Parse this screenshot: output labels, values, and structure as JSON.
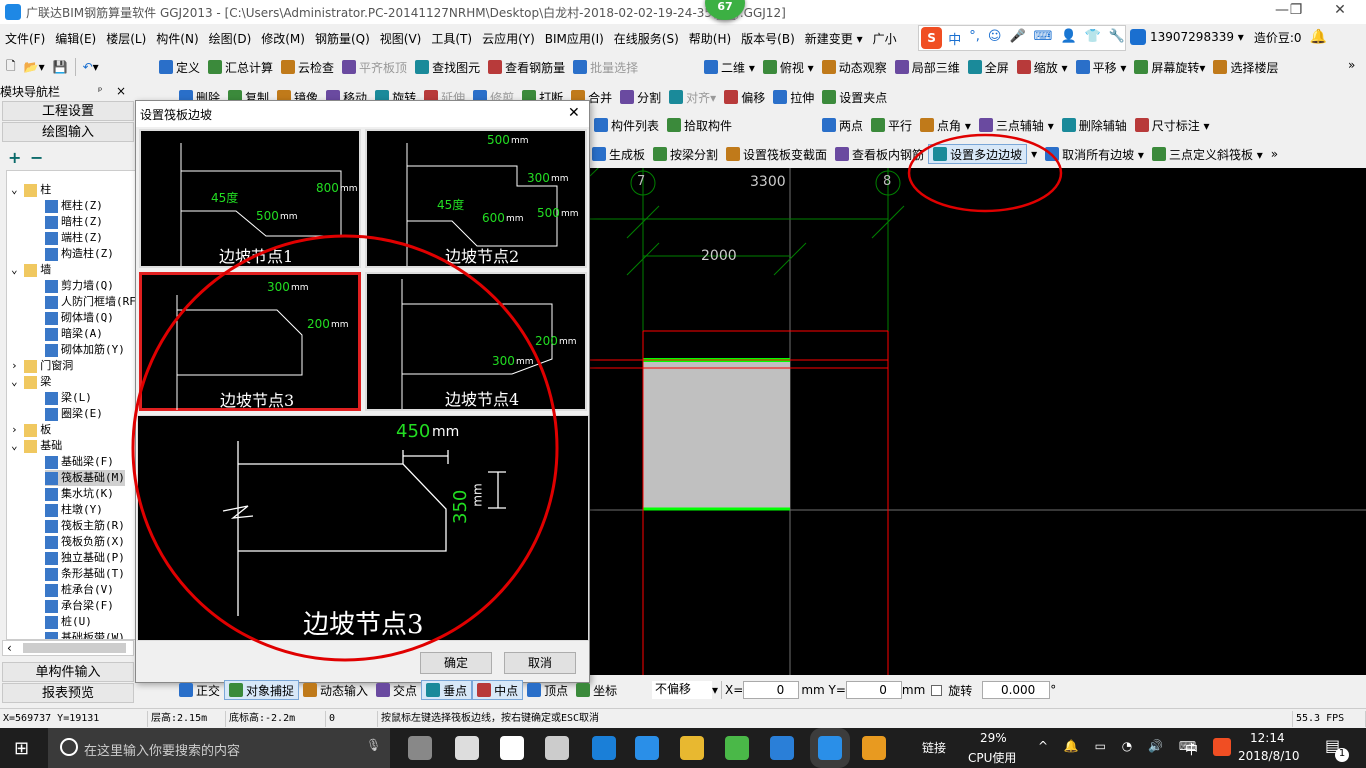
{
  "title": "广联达BIM钢筋算量软件 GGJ2013 - [C:\\Users\\Administrator.PC-20141127NRHM\\Desktop\\白龙村-2018-02-02-19-24-35(██).GGJ12]",
  "badge": "67",
  "window_controls": {
    "min": "—",
    "max": "❐",
    "close": "✕"
  },
  "menu": [
    "文件(F)",
    "编辑(E)",
    "楼层(L)",
    "构件(N)",
    "绘图(D)",
    "修改(M)",
    "钢筋量(Q)",
    "视图(V)",
    "工具(T)",
    "云应用(Y)",
    "BIM应用(I)",
    "在线服务(S)",
    "帮助(H)",
    "版本号(B)",
    "新建变更 ▾",
    "广小"
  ],
  "ime": {
    "logo": "S",
    "items": [
      "中",
      "°,",
      "☺",
      "🎤",
      "⌨",
      "👤",
      "👕",
      "🔧"
    ]
  },
  "account": {
    "phone": "13907298339 ▾",
    "beans": "造价豆:0"
  },
  "toolbar1": {
    "left": [
      "▾",
      "▾"
    ],
    "main": [
      "定义",
      "汇总计算",
      "云检查",
      "平齐板顶",
      "查找图元",
      "查看钢筋量",
      "批量选择"
    ],
    "view": [
      "二维 ▾",
      "俯视 ▾",
      "动态观察",
      "局部三维",
      "全屏",
      "缩放 ▾",
      "平移 ▾",
      "屏幕旋转▾",
      "选择楼层"
    ],
    "more": "»"
  },
  "toolbar2": [
    "删除",
    "复制",
    "镜像",
    "移动",
    "旋转",
    "延伸",
    "修剪",
    "打断",
    "合并",
    "分割",
    "对齐▾",
    "偏移",
    "拉伸",
    "设置夹点"
  ],
  "toolbar3": {
    "a": [
      "构件列表",
      "拾取构件"
    ],
    "b": [
      "两点",
      "平行",
      "点角 ▾",
      "三点辅轴 ▾",
      "删除辅轴",
      "尺寸标注 ▾"
    ]
  },
  "toolbar4": [
    "生成板",
    "按梁分割",
    "设置筏板变截面",
    "查看板内钢筋",
    "设置多边边坡",
    "▾",
    "取消所有边坡 ▾",
    "三点定义斜筏板 ▾",
    "»"
  ],
  "nav": {
    "title": "模块导航栏",
    "pin": "📌",
    "close": "×",
    "project_settings": "工程设置",
    "drawing_input": "绘图输入",
    "single_input": "单构件输入",
    "report_preview": "报表预览",
    "expand": "+",
    "collapse": "−"
  },
  "tree": [
    {
      "label": "柱",
      "level": 0,
      "folder": true
    },
    {
      "label": "框柱(Z)",
      "level": 1
    },
    {
      "label": "暗柱(Z)",
      "level": 1
    },
    {
      "label": "端柱(Z)",
      "level": 1
    },
    {
      "label": "构造柱(Z)",
      "level": 1
    },
    {
      "label": "墙",
      "level": 0,
      "folder": true
    },
    {
      "label": "剪力墙(Q)",
      "level": 1
    },
    {
      "label": "人防门框墙(RF)",
      "level": 1
    },
    {
      "label": "砌体墙(Q)",
      "level": 1
    },
    {
      "label": "暗梁(A)",
      "level": 1
    },
    {
      "label": "砌体加筋(Y)",
      "level": 1
    },
    {
      "label": "门窗洞",
      "level": 0,
      "folder": true,
      "collapsed": true
    },
    {
      "label": "梁",
      "level": 0,
      "folder": true
    },
    {
      "label": "梁(L)",
      "level": 1
    },
    {
      "label": "圈梁(E)",
      "level": 1
    },
    {
      "label": "板",
      "level": 0,
      "folder": true,
      "collapsed": true
    },
    {
      "label": "基础",
      "level": 0,
      "folder": true
    },
    {
      "label": "基础梁(F)",
      "level": 1
    },
    {
      "label": "筏板基础(M)",
      "level": 1,
      "selected": true
    },
    {
      "label": "集水坑(K)",
      "level": 1
    },
    {
      "label": "柱墩(Y)",
      "level": 1
    },
    {
      "label": "筏板主筋(R)",
      "level": 1
    },
    {
      "label": "筏板负筋(X)",
      "level": 1
    },
    {
      "label": "独立基础(P)",
      "level": 1
    },
    {
      "label": "条形基础(T)",
      "level": 1
    },
    {
      "label": "桩承台(V)",
      "level": 1
    },
    {
      "label": "承台梁(F)",
      "level": 1
    },
    {
      "label": "桩(U)",
      "level": 1
    },
    {
      "label": "基础板带(W)",
      "level": 1
    }
  ],
  "dialog": {
    "title": "设置筏板边坡",
    "close": "✕",
    "ok": "确定",
    "cancel": "取消",
    "options": [
      {
        "label": "边坡节点1",
        "angle": "45度",
        "d1": "500",
        "d2": "800",
        "unit": "mm"
      },
      {
        "label": "边坡节点2",
        "angle": "45度",
        "d1": "500",
        "d2": "300",
        "d3": "500",
        "d4": "600",
        "unit": "mm"
      },
      {
        "label": "边坡节点3",
        "d1": "300",
        "d2": "200",
        "unit": "mm",
        "selected": true
      },
      {
        "label": "边坡节点4",
        "d1": "300",
        "d2": "200",
        "unit": "mm"
      }
    ],
    "preview": {
      "label": "边坡节点3",
      "d1": "450",
      "d2": "350",
      "unit": "mm"
    }
  },
  "canvas": {
    "axis_left": "7",
    "axis_right": "8",
    "dim_top": "3300",
    "dim_inner": "2000"
  },
  "bottom_toolbar": {
    "items": [
      "正交",
      "对象捕捉",
      "动态输入",
      "交点",
      "垂点",
      "中点",
      "顶点",
      "坐标"
    ],
    "offset": "不偏移",
    "x_label": "X=",
    "x": "0",
    "y_label": "mm Y=",
    "y": "0",
    "mm": "mm",
    "rotate": "旋转",
    "angle": "0.000",
    "deg": "°"
  },
  "status": {
    "coords": "X=569737 Y=19131",
    "floor_height": "层高:2.15m",
    "bottom_elev": "底标高:-2.2m",
    "zero": "0",
    "hint": "按鼠标左键选择筏板边线，按右键确定或ESC取消",
    "fps": "55.3 FPS"
  },
  "taskbar": {
    "search": "在这里输入你要搜索的内容",
    "link": "链接",
    "cpu": "29%",
    "cpu_label": "CPU使用",
    "time": "12:14",
    "date": "2018/8/10",
    "ime": "中",
    "notif": "1"
  },
  "colors": {
    "annotation": "#e00000",
    "grid": "#008000",
    "wall": "#ff0000",
    "slab": "#c0c0c0",
    "highlight_edge": "#00ff00"
  }
}
